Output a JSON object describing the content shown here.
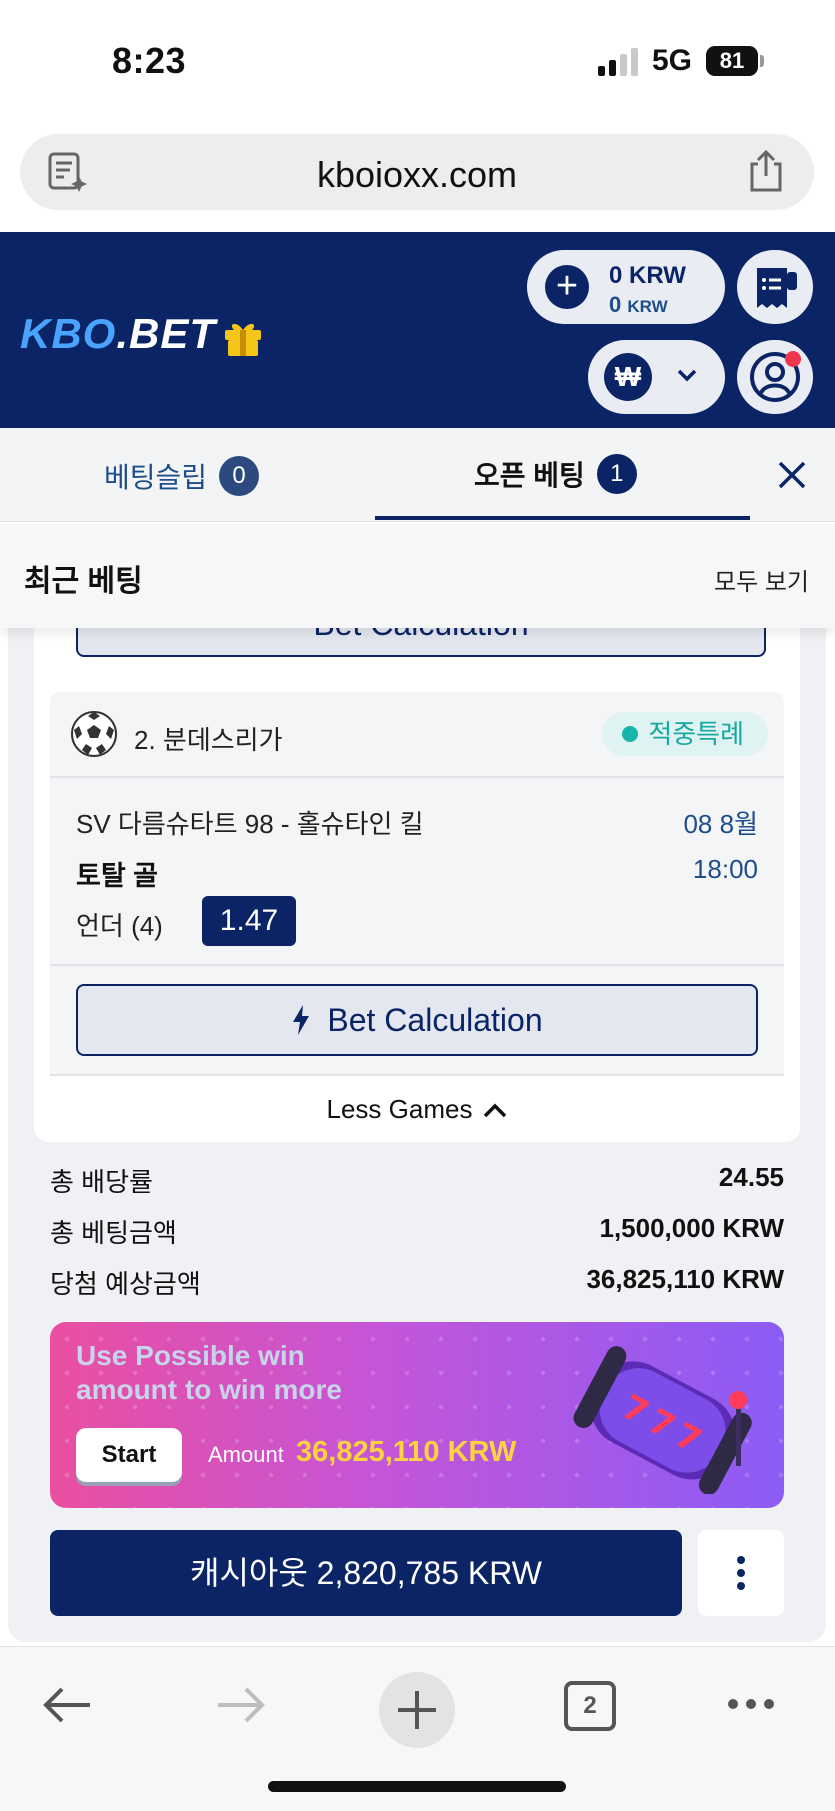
{
  "status": {
    "time": "8:23",
    "network": "5G",
    "battery": "81"
  },
  "browser": {
    "url": "kboioxx.com",
    "tab_count": "2"
  },
  "site": {
    "logo_kbo": "KBO",
    "logo_rest": ".BET",
    "balance_main": "0 KRW",
    "balance_bonus_value": "0",
    "balance_bonus_unit": "KRW",
    "currency_symbol": "₩"
  },
  "tabs": {
    "betslip_label": "베팅슬립",
    "betslip_count": "0",
    "open_label": "오픈 베팅",
    "open_count": "1"
  },
  "recent": {
    "title": "최근 베팅",
    "view_all": "모두 보기"
  },
  "bet_calc_label": "Bet Calculation",
  "leg": {
    "league": "2. 분데스리가",
    "badge": "적중특례",
    "match": "SV 다름슈타트 98 - 홀슈타인 킬",
    "date": "08 8월",
    "market": "토탈 골",
    "time": "18:00",
    "selection": "언더 (4)",
    "odds": "1.47"
  },
  "less_games": "Less Games",
  "summary": {
    "total_odds_label": "총 배당률",
    "total_odds": "24.55",
    "total_stake_label": "총 베팅금액",
    "total_stake": "1,500,000 KRW",
    "potential_label": "당첨 예상금액",
    "potential": "36,825,110 KRW"
  },
  "promo": {
    "line1": "Use Possible win",
    "line2": "amount to win more",
    "start": "Start",
    "amount_label": "Amount",
    "amount": "36,825,110 KRW"
  },
  "cashout": "캐시아웃 2,820,785 KRW",
  "colors": {
    "brand_navy": "#0b2466",
    "accent_teal": "#17a9a0",
    "promo_gold": "#ffd23f"
  }
}
